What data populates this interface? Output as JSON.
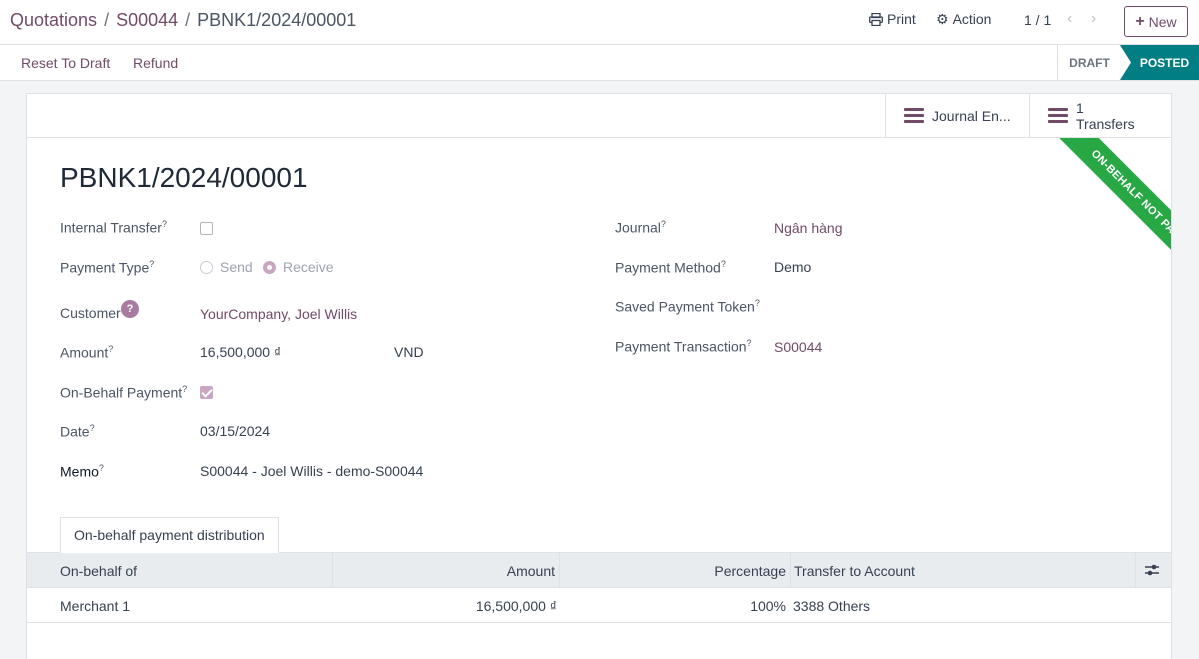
{
  "breadcrumb": {
    "items": [
      "Quotations",
      "S00044"
    ],
    "separator": "/",
    "current": "PBNK1/2024/00001"
  },
  "toolbar": {
    "print_label": "Print",
    "action_label": "Action",
    "pager": "1 / 1",
    "new_label": "New"
  },
  "statusbar": {
    "reset_label": "Reset To Draft",
    "refund_label": "Refund",
    "stages": [
      "DRAFT",
      "POSTED"
    ],
    "active_stage": "POSTED"
  },
  "smart_buttons": {
    "journal_label": "Journal En...",
    "transfers_count": "1",
    "transfers_label": "Transfers"
  },
  "ribbon": "ON-BEHALF NOT PAID",
  "record": {
    "title": "PBNK1/2024/00001",
    "left_fields": {
      "internal_transfer": {
        "label": "Internal Transfer",
        "checked": false
      },
      "payment_type": {
        "label": "Payment Type",
        "options": [
          "Send",
          "Receive"
        ],
        "selected": "Receive"
      },
      "customer": {
        "label": "Customer",
        "value": "YourCompany, Joel Willis"
      },
      "amount": {
        "label": "Amount",
        "value": "16,500,000 ₫",
        "currency": "VND"
      },
      "on_behalf_payment": {
        "label": "On-Behalf Payment",
        "checked": true
      },
      "date": {
        "label": "Date",
        "value": "03/15/2024"
      },
      "memo": {
        "label": "Memo",
        "value": "S00044 - Joel Willis - demo-S00044"
      }
    },
    "right_fields": {
      "journal": {
        "label": "Journal",
        "value": "Ngân hàng"
      },
      "payment_method": {
        "label": "Payment Method",
        "value": "Demo"
      },
      "saved_token": {
        "label": "Saved Payment Token",
        "value": ""
      },
      "payment_transaction": {
        "label": "Payment Transaction",
        "value": "S00044"
      }
    }
  },
  "notebook": {
    "tab_label": "On-behalf payment distribution",
    "columns": [
      "On-behalf of",
      "Amount",
      "Percentage",
      "Transfer to Account"
    ],
    "rows": [
      {
        "on_behalf_of": "Merchant 1",
        "amount": "16,500,000 ₫",
        "percentage": "100%",
        "transfer_to_account": "3388 Others"
      }
    ]
  },
  "colors": {
    "brand": "#714B67",
    "posted": "#017e84",
    "ribbon": "#28a745"
  }
}
